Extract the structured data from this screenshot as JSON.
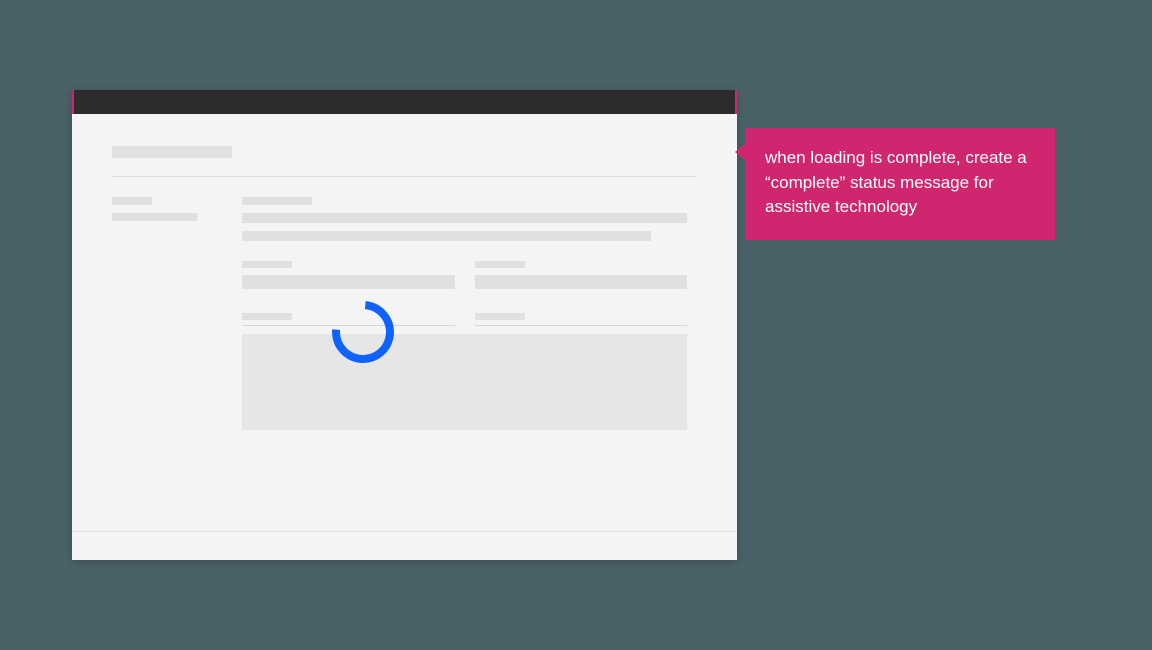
{
  "callout": {
    "text": "when loading is complete, create a “complete” status message for assistive technology"
  },
  "colors": {
    "callout_bg": "#d02670",
    "spinner": "#0f62fe",
    "page_bg": "#4a6168",
    "window_bg": "#f4f4f4"
  }
}
